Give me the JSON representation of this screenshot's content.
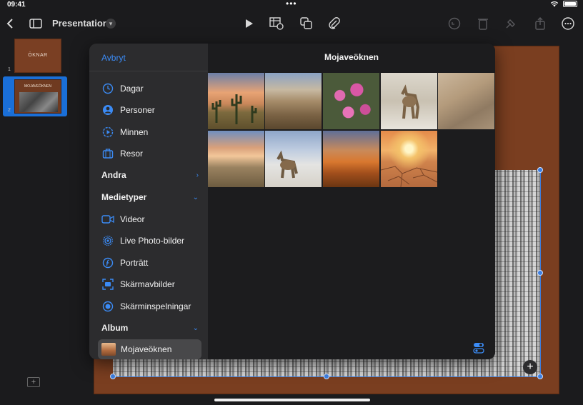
{
  "status": {
    "time": "09:41",
    "dots": "•••"
  },
  "toolbar": {
    "title": "Presentation",
    "icons": [
      "back-chevron-icon",
      "sidebar-icon",
      "play-icon",
      "table-icon",
      "shapes-icon",
      "attachment-icon",
      "undo-icon",
      "delete-icon",
      "paintbrush-icon",
      "share-icon",
      "more-icon"
    ]
  },
  "navigator": {
    "slides": [
      {
        "number": "1",
        "title": "ÖKNAR"
      },
      {
        "number": "2",
        "title": "MOJAVEÖKNEN"
      }
    ]
  },
  "picker": {
    "cancel_label": "Avbryt",
    "album_title": "Mojaveöknen",
    "library_items": [
      {
        "label": "Dagar",
        "icon": "calendar-clock-icon"
      },
      {
        "label": "Personer",
        "icon": "person-circle-icon"
      },
      {
        "label": "Minnen",
        "icon": "memories-play-icon"
      },
      {
        "label": "Resor",
        "icon": "suitcase-icon"
      }
    ],
    "section_other": "Andra",
    "section_media": "Medietyper",
    "media_items": [
      {
        "label": "Videor",
        "icon": "video-icon"
      },
      {
        "label": "Live Photo-bilder",
        "icon": "live-photo-icon"
      },
      {
        "label": "Porträtt",
        "icon": "portrait-f-icon"
      },
      {
        "label": "Skärmavbilder",
        "icon": "screenshot-icon"
      },
      {
        "label": "Skärminspelningar",
        "icon": "screen-recording-icon"
      }
    ],
    "section_album": "Album",
    "albums": [
      {
        "label": "Mojaveöknen"
      }
    ],
    "photos": [
      "cactus-sunset",
      "desert-valley",
      "pink-cactus-flowers",
      "coyote-snow",
      "rocky-ground",
      "desert-clouds",
      "coyote-salt-flat",
      "orange-flowers-dusk",
      "cracked-earth-sunset"
    ]
  },
  "colors": {
    "accent": "#3b8bf5",
    "sidebar_bg": "#2c2c2e",
    "slide_bg": "#7a3e20"
  }
}
